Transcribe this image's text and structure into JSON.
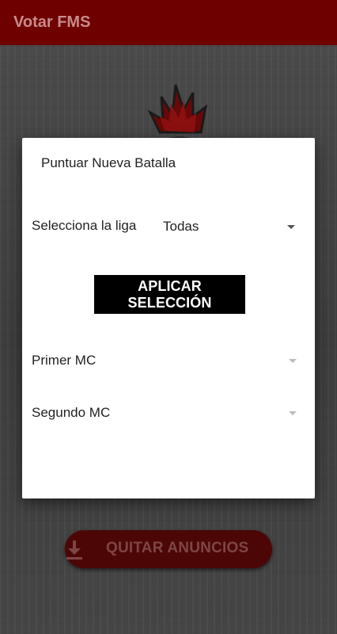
{
  "appbar": {
    "title": "Votar FMS"
  },
  "dialog": {
    "title": "Puntuar Nueva Batalla",
    "league_label": "Selecciona la liga",
    "league_selected": "Todas",
    "apply_button": "APLICAR SELECCIÓN",
    "first_mc_placeholder": "Primer MC",
    "second_mc_placeholder": "Segundo MC"
  },
  "background": {
    "ad_button": "QUITAR ANUNCIOS"
  },
  "colors": {
    "appbar": "#6e0000",
    "accent_red": "#b00000",
    "dialog_bg": "#ffffff",
    "button_bg": "#000000"
  },
  "icons": {
    "mascot": "rooster-mascot-icon",
    "download": "download-icon",
    "dropdown": "caret-down-icon"
  }
}
